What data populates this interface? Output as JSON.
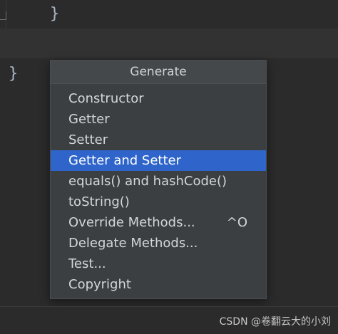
{
  "editor": {
    "line1": "}",
    "line2": "}"
  },
  "popup": {
    "title": "Generate",
    "items": [
      {
        "label": "Constructor"
      },
      {
        "label": "Getter"
      },
      {
        "label": "Setter"
      },
      {
        "label": "Getter and Setter",
        "selected": true
      },
      {
        "label": "equals() and hashCode()"
      },
      {
        "label": "toString()"
      },
      {
        "label": "Override Methods...",
        "shortcut": "^O"
      },
      {
        "label": "Delegate Methods..."
      },
      {
        "label": "Test..."
      },
      {
        "label": "Copyright"
      }
    ]
  },
  "watermark": "CSDN @卷翻云大的小刘",
  "colors": {
    "background": "#2b2b2b",
    "popup_bg": "#3c3f41",
    "selection": "#2f65ca",
    "code_text": "#a9b7c6"
  }
}
